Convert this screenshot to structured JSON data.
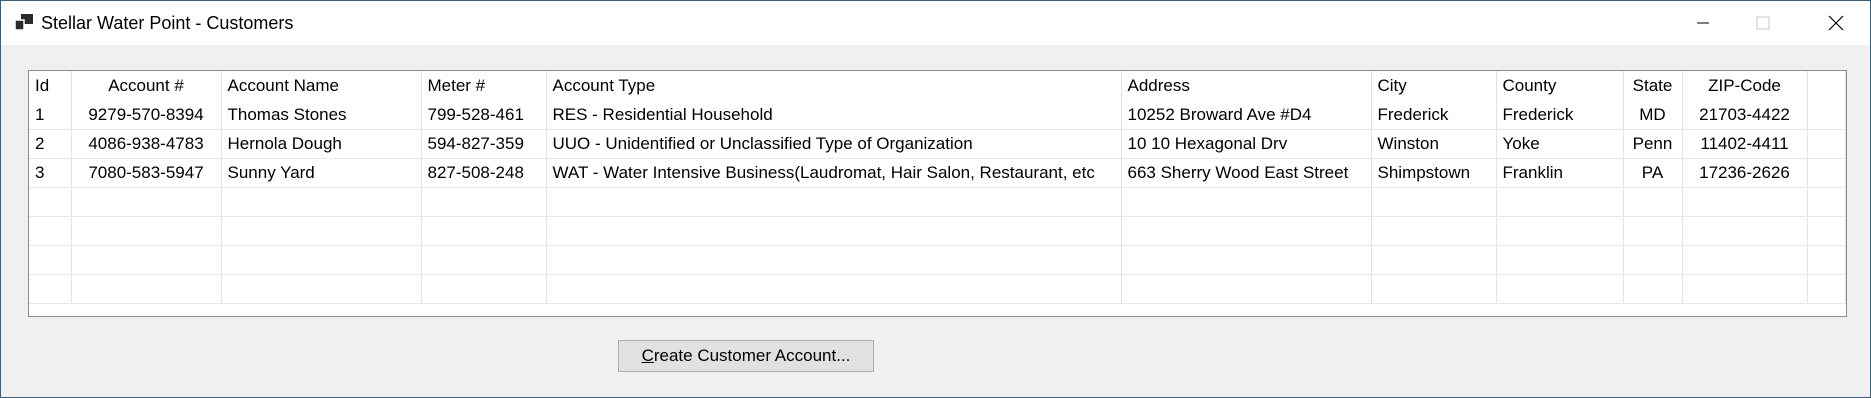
{
  "window": {
    "title": "Stellar Water Point - Customers"
  },
  "grid": {
    "columns": [
      "Id",
      "Account #",
      "Account Name",
      "Meter #",
      "Account Type",
      "Address",
      "City",
      "County",
      "State",
      "ZIP-Code"
    ],
    "rows": [
      [
        "1",
        "9279-570-8394",
        "Thomas Stones",
        "799-528-461",
        "RES - Residential Household",
        "10252 Broward Ave #D4",
        "Frederick",
        "Frederick",
        "MD",
        "21703-4422"
      ],
      [
        "2",
        "4086-938-4783",
        "Hernola Dough",
        "594-827-359",
        "UUO - Unidentified or Unclassified Type of Organization",
        "10 10 Hexagonal Drv",
        "Winston",
        "Yoke",
        "Penn",
        "11402-4411"
      ],
      [
        "3",
        "7080-583-5947",
        "Sunny Yard",
        "827-508-248",
        "WAT - Water Intensive Business(Laudromat, Hair Salon, Restaurant, etc",
        "663 Sherry Wood East Street",
        "Shimpstown",
        "Franklin",
        "PA",
        "17236-2626"
      ]
    ]
  },
  "actions": {
    "create_button_first": "C",
    "create_button_rest": "reate Customer Account..."
  }
}
